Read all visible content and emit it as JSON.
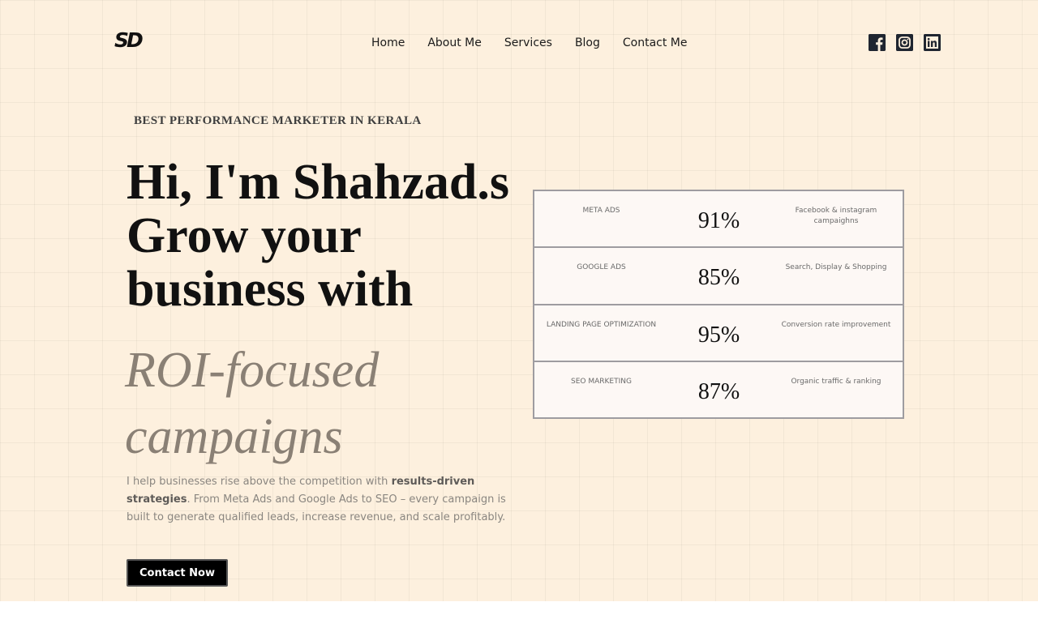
{
  "brand": {
    "logo": "SD"
  },
  "nav": {
    "items": [
      {
        "label": "Home"
      },
      {
        "label": "About Me"
      },
      {
        "label": "Services"
      },
      {
        "label": "Blog"
      },
      {
        "label": "Contact Me"
      }
    ]
  },
  "social": [
    {
      "icon": "facebook-icon"
    },
    {
      "icon": "instagram-icon"
    },
    {
      "icon": "linkedin-icon"
    }
  ],
  "hero": {
    "eyebrow": "BEST PERFORMANCE MARKETER IN KERALA",
    "headline_line1": "Hi, I'm Shahzad.s",
    "headline_line2": "Grow your",
    "headline_line3": "business with",
    "accent_line1": "ROI-focused",
    "accent_line2": "campaigns",
    "desc_part1": "I help businesses rise above the competition with ",
    "desc_bold": "results-driven strategies",
    "desc_part2": ". From Meta Ads and Google Ads to SEO – every campaign is built to generate qualified leads, increase revenue, and scale profitably.",
    "cta_label": "Contact Now"
  },
  "stats": [
    {
      "label": "META ADS",
      "value": "91%",
      "desc": "Facebook & instagram campaighns"
    },
    {
      "label": "GOOGLE ADS",
      "value": "85%",
      "desc": "Search, Display & Shopping"
    },
    {
      "label": "LANDING PAGE OPTIMIZATION",
      "value": "95%",
      "desc": "Conversion rate improvement"
    },
    {
      "label": "SEO MARKETING",
      "value": "87%",
      "desc": "Organic traffic & ranking"
    }
  ],
  "colors": {
    "background": "#fdf0de",
    "accent_text": "#8a8075",
    "button": "#000000",
    "table_border": "#9e9ca0"
  }
}
